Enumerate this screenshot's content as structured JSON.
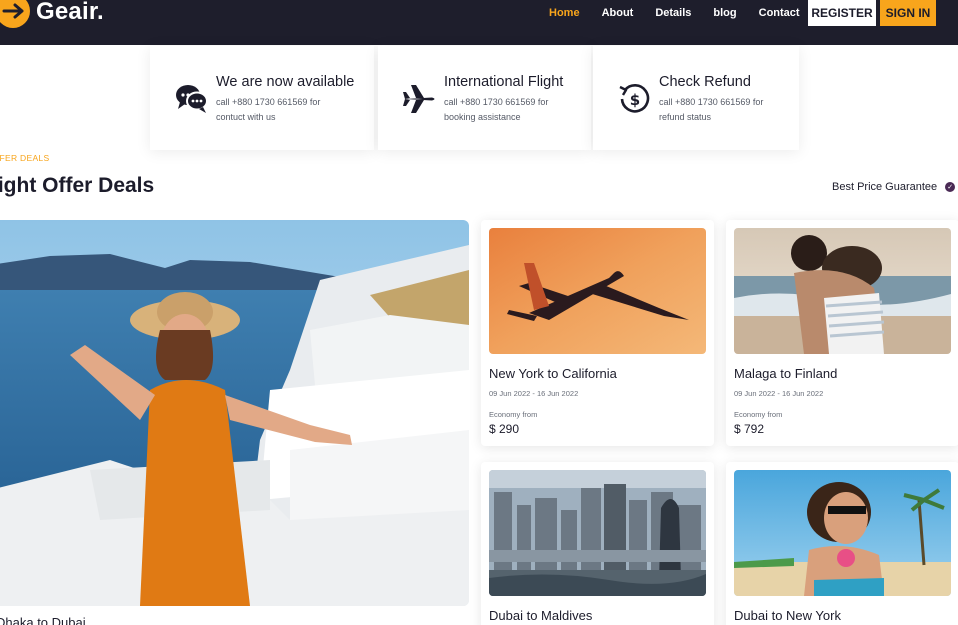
{
  "brand": {
    "name": "Geair.",
    "accent": "#f8a51c",
    "header_bg": "#1e1e2c"
  },
  "nav": [
    {
      "label": "Home",
      "active": true
    },
    {
      "label": "About",
      "active": false
    },
    {
      "label": "Details",
      "active": false
    },
    {
      "label": "blog",
      "active": false
    },
    {
      "label": "Contact",
      "active": false
    }
  ],
  "auth": {
    "register_label": "REGISTER",
    "signin_label": "SIGN IN"
  },
  "info_cards": [
    {
      "icon": "chat-icon",
      "title": "We are now available",
      "line1": "call +880 1730 661569 for",
      "line2": "contuct with us"
    },
    {
      "icon": "airplane-icon",
      "title": "International Flight",
      "line1": "call +880 1730 661569 for",
      "line2": "booking assistance"
    },
    {
      "icon": "refund-icon",
      "title": "Check Refund",
      "line1": "call +880 1730 661569 for",
      "line2": "refund status"
    }
  ],
  "section": {
    "kicker": "FFER DEALS",
    "title": "light Offer Deals",
    "guarantee": "Best Price Guarantee"
  },
  "featured": {
    "caption": "Dhaka to Dubai",
    "image": "woman-santorini-photo"
  },
  "deals": [
    {
      "route": "New York to California",
      "dates": "09 Jun 2022 - 16 Jun 2022",
      "from_label": "Economy from",
      "price": "$ 290",
      "image": "airplane-sunset-photo"
    },
    {
      "route": "Malaga to Finland",
      "dates": "09 Jun 2022 - 16 Jun 2022",
      "from_label": "Economy from",
      "price": "$ 792",
      "image": "beach-couple-photo"
    },
    {
      "route": "Dubai to Maldives",
      "image": "city-skyline-photo"
    },
    {
      "route": "Dubai to New York",
      "image": "beach-woman-photo"
    }
  ]
}
